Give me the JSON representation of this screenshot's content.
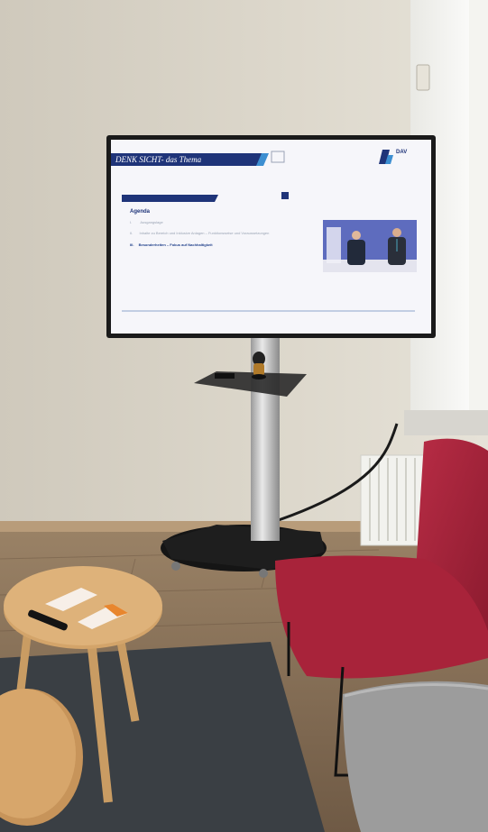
{
  "scene": {
    "description_tag": "photo",
    "colors": {
      "wall": "#d9d3c6",
      "floor": "#8a735c",
      "rug": "#3a3f44",
      "chair_red": "#a8233a",
      "chair_grey": "#9a9a9a",
      "table_wood": "#d3a46a",
      "screen_frame": "#1a1a1a"
    }
  },
  "screen": {
    "slide_header": "DENK SICHT- das Thema",
    "logo_text": "DAV",
    "agenda_title": "Agenda",
    "agenda_items": [
      {
        "num": "I.",
        "text": "Ausgangslage",
        "active": false
      },
      {
        "num": "II.",
        "text": "Inhalte zu Bereich und Inklusive Anlagen – Funktionsweise und Voraussetzungen",
        "active": false
      },
      {
        "num": "III.",
        "text": "Besonderheiten – Fokus auf Nachhaltigkeit",
        "active": true
      }
    ]
  }
}
